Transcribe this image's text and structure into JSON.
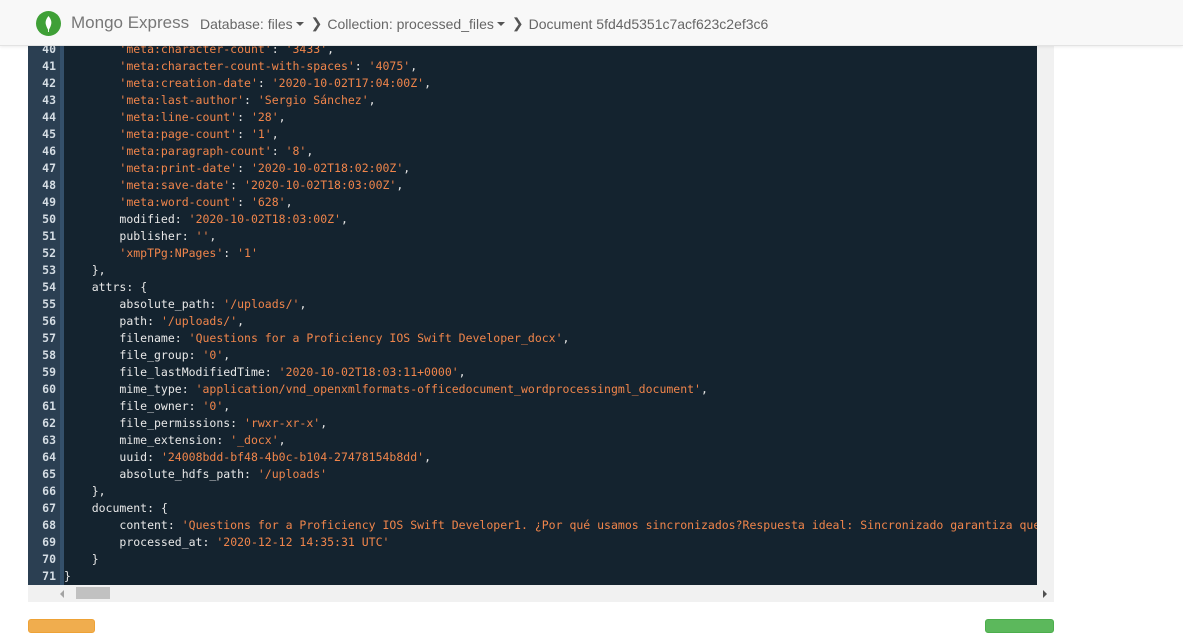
{
  "navbar": {
    "brand": "Mongo Express",
    "breadcrumbs": {
      "database": "Database: files",
      "collection": "Collection: processed_files",
      "document": "Document 5fd4d5351c7acf623c2ef3c6"
    }
  },
  "editor": {
    "lines": [
      {
        "n": "40",
        "ind": "        ",
        "key": "'meta:character-count'",
        "sep": ": ",
        "val": "'3433'",
        "end": ","
      },
      {
        "n": "41",
        "ind": "        ",
        "key": "'meta:character-count-with-spaces'",
        "sep": ": ",
        "val": "'4075'",
        "end": ","
      },
      {
        "n": "42",
        "ind": "        ",
        "key": "'meta:creation-date'",
        "sep": ": ",
        "val": "'2020-10-02T17:04:00Z'",
        "end": ","
      },
      {
        "n": "43",
        "ind": "        ",
        "key": "'meta:last-author'",
        "sep": ": ",
        "val": "'Sergio Sánchez'",
        "end": ","
      },
      {
        "n": "44",
        "ind": "        ",
        "key": "'meta:line-count'",
        "sep": ": ",
        "val": "'28'",
        "end": ","
      },
      {
        "n": "45",
        "ind": "        ",
        "key": "'meta:page-count'",
        "sep": ": ",
        "val": "'1'",
        "end": ","
      },
      {
        "n": "46",
        "ind": "        ",
        "key": "'meta:paragraph-count'",
        "sep": ": ",
        "val": "'8'",
        "end": ","
      },
      {
        "n": "47",
        "ind": "        ",
        "key": "'meta:print-date'",
        "sep": ": ",
        "val": "'2020-10-02T18:02:00Z'",
        "end": ","
      },
      {
        "n": "48",
        "ind": "        ",
        "key": "'meta:save-date'",
        "sep": ": ",
        "val": "'2020-10-02T18:03:00Z'",
        "end": ","
      },
      {
        "n": "49",
        "ind": "        ",
        "key": "'meta:word-count'",
        "sep": ": ",
        "val": "'628'",
        "end": ","
      },
      {
        "n": "50",
        "ind": "        ",
        "key": "modified",
        "sep": ": ",
        "val": "'2020-10-02T18:03:00Z'",
        "end": ","
      },
      {
        "n": "51",
        "ind": "        ",
        "key": "publisher",
        "sep": ": ",
        "val": "''",
        "end": ","
      },
      {
        "n": "52",
        "ind": "        ",
        "key": "'xmpTPg:NPages'",
        "sep": ": ",
        "val": "'1'",
        "end": ""
      },
      {
        "n": "53",
        "ind": "    ",
        "key": "",
        "sep": "",
        "val": "",
        "end": "},"
      },
      {
        "n": "54",
        "ind": "    ",
        "key": "attrs",
        "sep": ": ",
        "val": "",
        "end": "{"
      },
      {
        "n": "55",
        "ind": "        ",
        "key": "absolute_path",
        "sep": ": ",
        "val": "'/uploads/'",
        "end": ","
      },
      {
        "n": "56",
        "ind": "        ",
        "key": "path",
        "sep": ": ",
        "val": "'/uploads/'",
        "end": ","
      },
      {
        "n": "57",
        "ind": "        ",
        "key": "filename",
        "sep": ": ",
        "val": "'Questions for a Proficiency IOS Swift Developer_docx'",
        "end": ","
      },
      {
        "n": "58",
        "ind": "        ",
        "key": "file_group",
        "sep": ": ",
        "val": "'0'",
        "end": ","
      },
      {
        "n": "59",
        "ind": "        ",
        "key": "file_lastModifiedTime",
        "sep": ": ",
        "val": "'2020-10-02T18:03:11+0000'",
        "end": ","
      },
      {
        "n": "60",
        "ind": "        ",
        "key": "mime_type",
        "sep": ": ",
        "val": "'application/vnd_openxmlformats-officedocument_wordprocessingml_document'",
        "end": ","
      },
      {
        "n": "61",
        "ind": "        ",
        "key": "file_owner",
        "sep": ": ",
        "val": "'0'",
        "end": ","
      },
      {
        "n": "62",
        "ind": "        ",
        "key": "file_permissions",
        "sep": ": ",
        "val": "'rwxr-xr-x'",
        "end": ","
      },
      {
        "n": "63",
        "ind": "        ",
        "key": "mime_extension",
        "sep": ": ",
        "val": "'_docx'",
        "end": ","
      },
      {
        "n": "64",
        "ind": "        ",
        "key": "uuid",
        "sep": ": ",
        "val": "'24008bdd-bf48-4b0c-b104-27478154b8dd'",
        "end": ","
      },
      {
        "n": "65",
        "ind": "        ",
        "key": "absolute_hdfs_path",
        "sep": ": ",
        "val": "'/uploads'",
        "end": ""
      },
      {
        "n": "66",
        "ind": "    ",
        "key": "",
        "sep": "",
        "val": "",
        "end": "},"
      },
      {
        "n": "67",
        "ind": "    ",
        "key": "document",
        "sep": ": ",
        "val": "",
        "end": "{"
      },
      {
        "n": "68",
        "ind": "        ",
        "key": "content",
        "sep": ": ",
        "val": "'Questions for a Proficiency IOS Swift Developer1. ¿Por qué usamos sincronizados?Respuesta ideal: Sincronizado garantiza que",
        "end": ""
      },
      {
        "n": "69",
        "ind": "        ",
        "key": "processed_at",
        "sep": ": ",
        "val": "'2020-12-12 14:35:31 UTC'",
        "end": ""
      },
      {
        "n": "70",
        "ind": "    ",
        "key": "",
        "sep": "",
        "val": "",
        "end": "}"
      },
      {
        "n": "71",
        "ind": "",
        "key": "",
        "sep": "",
        "val": "",
        "end": "}"
      }
    ]
  }
}
